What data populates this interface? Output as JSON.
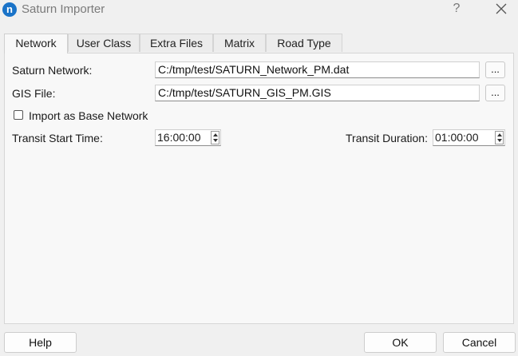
{
  "window": {
    "title": "Saturn Importer",
    "app_icon_glyph": "n",
    "help_glyph": "?"
  },
  "tabs": [
    "Network",
    "User Class",
    "Extra Files",
    "Matrix",
    "Road Type"
  ],
  "active_tab": "Network",
  "network": {
    "saturn_network_label": "Saturn Network:",
    "saturn_network_value": "C:/tmp/test/SATURN_Network_PM.dat",
    "gis_file_label": "GIS File:",
    "gis_file_value": "C:/tmp/test/SATURN_GIS_PM.GIS",
    "browse_label": "...",
    "import_base_label": "Import as Base Network",
    "import_base_checked": false,
    "transit_start_label": "Transit Start Time:",
    "transit_start_value": "16:00:00",
    "transit_duration_label": "Transit Duration:",
    "transit_duration_value": "01:00:00"
  },
  "buttons": {
    "help": "Help",
    "ok": "OK",
    "cancel": "Cancel"
  },
  "colors": {
    "accent": "#1a73c8",
    "background": "#f0f0f0",
    "panel": "#f8f8f8"
  }
}
